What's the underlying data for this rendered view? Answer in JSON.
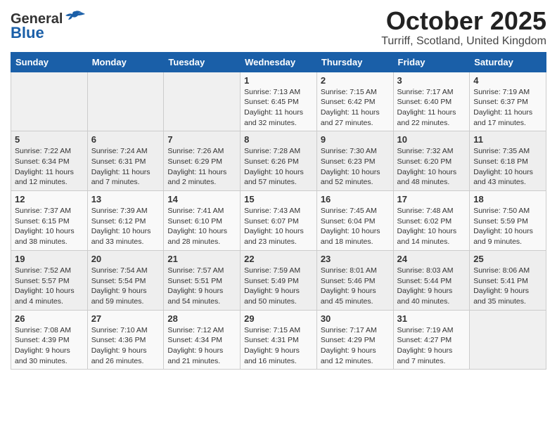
{
  "header": {
    "logo_general": "General",
    "logo_blue": "Blue",
    "month": "October 2025",
    "location": "Turriff, Scotland, United Kingdom"
  },
  "days_of_week": [
    "Sunday",
    "Monday",
    "Tuesday",
    "Wednesday",
    "Thursday",
    "Friday",
    "Saturday"
  ],
  "weeks": [
    [
      {
        "day": "",
        "info": ""
      },
      {
        "day": "",
        "info": ""
      },
      {
        "day": "",
        "info": ""
      },
      {
        "day": "1",
        "info": "Sunrise: 7:13 AM\nSunset: 6:45 PM\nDaylight: 11 hours\nand 32 minutes."
      },
      {
        "day": "2",
        "info": "Sunrise: 7:15 AM\nSunset: 6:42 PM\nDaylight: 11 hours\nand 27 minutes."
      },
      {
        "day": "3",
        "info": "Sunrise: 7:17 AM\nSunset: 6:40 PM\nDaylight: 11 hours\nand 22 minutes."
      },
      {
        "day": "4",
        "info": "Sunrise: 7:19 AM\nSunset: 6:37 PM\nDaylight: 11 hours\nand 17 minutes."
      }
    ],
    [
      {
        "day": "5",
        "info": "Sunrise: 7:22 AM\nSunset: 6:34 PM\nDaylight: 11 hours\nand 12 minutes."
      },
      {
        "day": "6",
        "info": "Sunrise: 7:24 AM\nSunset: 6:31 PM\nDaylight: 11 hours\nand 7 minutes."
      },
      {
        "day": "7",
        "info": "Sunrise: 7:26 AM\nSunset: 6:29 PM\nDaylight: 11 hours\nand 2 minutes."
      },
      {
        "day": "8",
        "info": "Sunrise: 7:28 AM\nSunset: 6:26 PM\nDaylight: 10 hours\nand 57 minutes."
      },
      {
        "day": "9",
        "info": "Sunrise: 7:30 AM\nSunset: 6:23 PM\nDaylight: 10 hours\nand 52 minutes."
      },
      {
        "day": "10",
        "info": "Sunrise: 7:32 AM\nSunset: 6:20 PM\nDaylight: 10 hours\nand 48 minutes."
      },
      {
        "day": "11",
        "info": "Sunrise: 7:35 AM\nSunset: 6:18 PM\nDaylight: 10 hours\nand 43 minutes."
      }
    ],
    [
      {
        "day": "12",
        "info": "Sunrise: 7:37 AM\nSunset: 6:15 PM\nDaylight: 10 hours\nand 38 minutes."
      },
      {
        "day": "13",
        "info": "Sunrise: 7:39 AM\nSunset: 6:12 PM\nDaylight: 10 hours\nand 33 minutes."
      },
      {
        "day": "14",
        "info": "Sunrise: 7:41 AM\nSunset: 6:10 PM\nDaylight: 10 hours\nand 28 minutes."
      },
      {
        "day": "15",
        "info": "Sunrise: 7:43 AM\nSunset: 6:07 PM\nDaylight: 10 hours\nand 23 minutes."
      },
      {
        "day": "16",
        "info": "Sunrise: 7:45 AM\nSunset: 6:04 PM\nDaylight: 10 hours\nand 18 minutes."
      },
      {
        "day": "17",
        "info": "Sunrise: 7:48 AM\nSunset: 6:02 PM\nDaylight: 10 hours\nand 14 minutes."
      },
      {
        "day": "18",
        "info": "Sunrise: 7:50 AM\nSunset: 5:59 PM\nDaylight: 10 hours\nand 9 minutes."
      }
    ],
    [
      {
        "day": "19",
        "info": "Sunrise: 7:52 AM\nSunset: 5:57 PM\nDaylight: 10 hours\nand 4 minutes."
      },
      {
        "day": "20",
        "info": "Sunrise: 7:54 AM\nSunset: 5:54 PM\nDaylight: 9 hours\nand 59 minutes."
      },
      {
        "day": "21",
        "info": "Sunrise: 7:57 AM\nSunset: 5:51 PM\nDaylight: 9 hours\nand 54 minutes."
      },
      {
        "day": "22",
        "info": "Sunrise: 7:59 AM\nSunset: 5:49 PM\nDaylight: 9 hours\nand 50 minutes."
      },
      {
        "day": "23",
        "info": "Sunrise: 8:01 AM\nSunset: 5:46 PM\nDaylight: 9 hours\nand 45 minutes."
      },
      {
        "day": "24",
        "info": "Sunrise: 8:03 AM\nSunset: 5:44 PM\nDaylight: 9 hours\nand 40 minutes."
      },
      {
        "day": "25",
        "info": "Sunrise: 8:06 AM\nSunset: 5:41 PM\nDaylight: 9 hours\nand 35 minutes."
      }
    ],
    [
      {
        "day": "26",
        "info": "Sunrise: 7:08 AM\nSunset: 4:39 PM\nDaylight: 9 hours\nand 30 minutes."
      },
      {
        "day": "27",
        "info": "Sunrise: 7:10 AM\nSunset: 4:36 PM\nDaylight: 9 hours\nand 26 minutes."
      },
      {
        "day": "28",
        "info": "Sunrise: 7:12 AM\nSunset: 4:34 PM\nDaylight: 9 hours\nand 21 minutes."
      },
      {
        "day": "29",
        "info": "Sunrise: 7:15 AM\nSunset: 4:31 PM\nDaylight: 9 hours\nand 16 minutes."
      },
      {
        "day": "30",
        "info": "Sunrise: 7:17 AM\nSunset: 4:29 PM\nDaylight: 9 hours\nand 12 minutes."
      },
      {
        "day": "31",
        "info": "Sunrise: 7:19 AM\nSunset: 4:27 PM\nDaylight: 9 hours\nand 7 minutes."
      },
      {
        "day": "",
        "info": ""
      }
    ]
  ]
}
